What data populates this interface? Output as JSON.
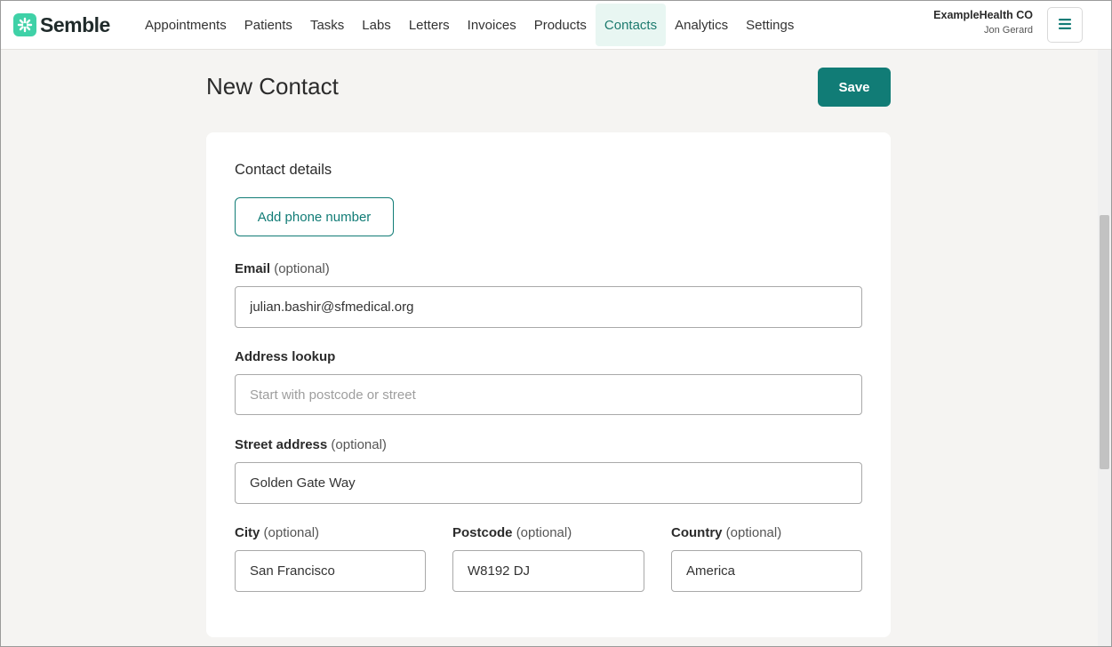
{
  "brand": {
    "name": "Semble",
    "accent": "#117c76",
    "logo_color": "#3fd1a7"
  },
  "nav": {
    "items": [
      {
        "label": "Appointments"
      },
      {
        "label": "Patients"
      },
      {
        "label": "Tasks"
      },
      {
        "label": "Labs"
      },
      {
        "label": "Letters"
      },
      {
        "label": "Invoices"
      },
      {
        "label": "Products"
      },
      {
        "label": "Contacts",
        "active": true
      },
      {
        "label": "Analytics"
      },
      {
        "label": "Settings"
      }
    ]
  },
  "account": {
    "org": "ExampleHealth CO",
    "user": "Jon Gerard"
  },
  "page": {
    "title": "New Contact",
    "save_label": "Save"
  },
  "form": {
    "section_title": "Contact details",
    "add_phone_label": "Add phone number",
    "optional_text": "(optional)",
    "email": {
      "label": "Email",
      "value": "julian.bashir@sfmedical.org"
    },
    "address_lookup": {
      "label": "Address lookup",
      "placeholder": "Start with postcode or street",
      "value": ""
    },
    "street": {
      "label": "Street address",
      "value": "Golden Gate Way"
    },
    "city": {
      "label": "City",
      "value": "San Francisco"
    },
    "postcode": {
      "label": "Postcode",
      "value": "W8192 DJ"
    },
    "country": {
      "label": "Country",
      "value": "America"
    }
  },
  "icons": {
    "logo": "semble-logo-icon",
    "menu": "hamburger-menu-icon"
  }
}
